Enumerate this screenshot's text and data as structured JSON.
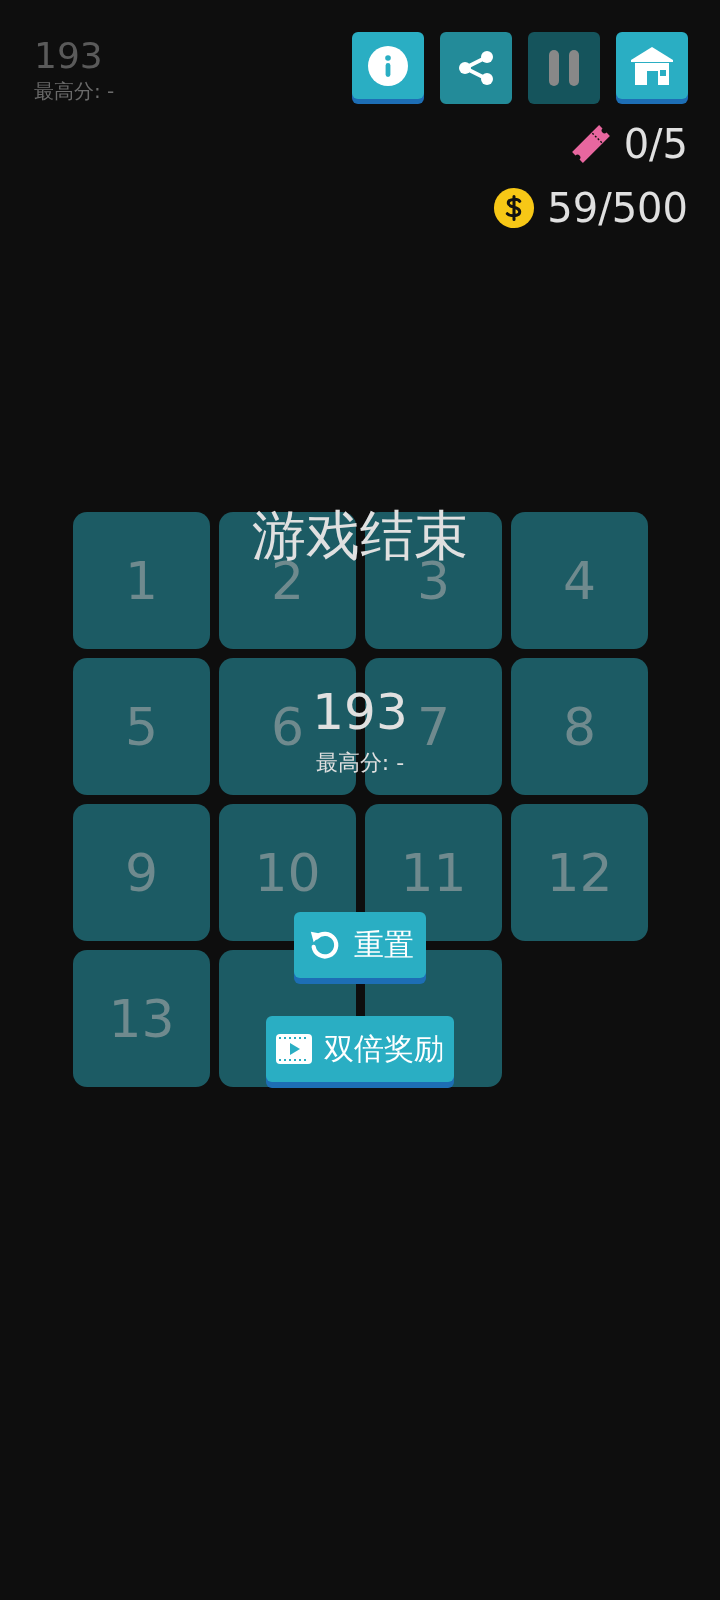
{
  "score_panel": {
    "score": "193",
    "best": "最高分:  -"
  },
  "toolbar": [
    {
      "kind": "info"
    },
    {
      "kind": "share"
    },
    {
      "kind": "pause"
    },
    {
      "kind": "home"
    }
  ],
  "counters": [
    {
      "kind": "ticket",
      "value": "0/5"
    },
    {
      "kind": "coin",
      "value": "59/500"
    }
  ],
  "board": {
    "tiles": [
      {
        "kind": "number",
        "label": "1"
      },
      {
        "kind": "number",
        "label": "2"
      },
      {
        "kind": "number",
        "label": "3"
      },
      {
        "kind": "number",
        "label": "4"
      },
      {
        "kind": "number",
        "label": "5"
      },
      {
        "kind": "number",
        "label": "6"
      },
      {
        "kind": "number",
        "label": "7"
      },
      {
        "kind": "number",
        "label": "8"
      },
      {
        "kind": "number",
        "label": "9"
      },
      {
        "kind": "number",
        "label": "10"
      },
      {
        "kind": "number",
        "label": "11"
      },
      {
        "kind": "number",
        "label": "12"
      },
      {
        "kind": "number",
        "label": "13"
      },
      {
        "kind": "covered"
      },
      {
        "kind": "covered"
      },
      {
        "kind": "empty"
      }
    ]
  },
  "game_over": {
    "title": "游戏结束",
    "score": "193",
    "best": "最高分:  -",
    "buttons": [
      {
        "kind": "reset",
        "label": "重置"
      },
      {
        "kind": "video",
        "label": "双倍奖励"
      }
    ]
  }
}
